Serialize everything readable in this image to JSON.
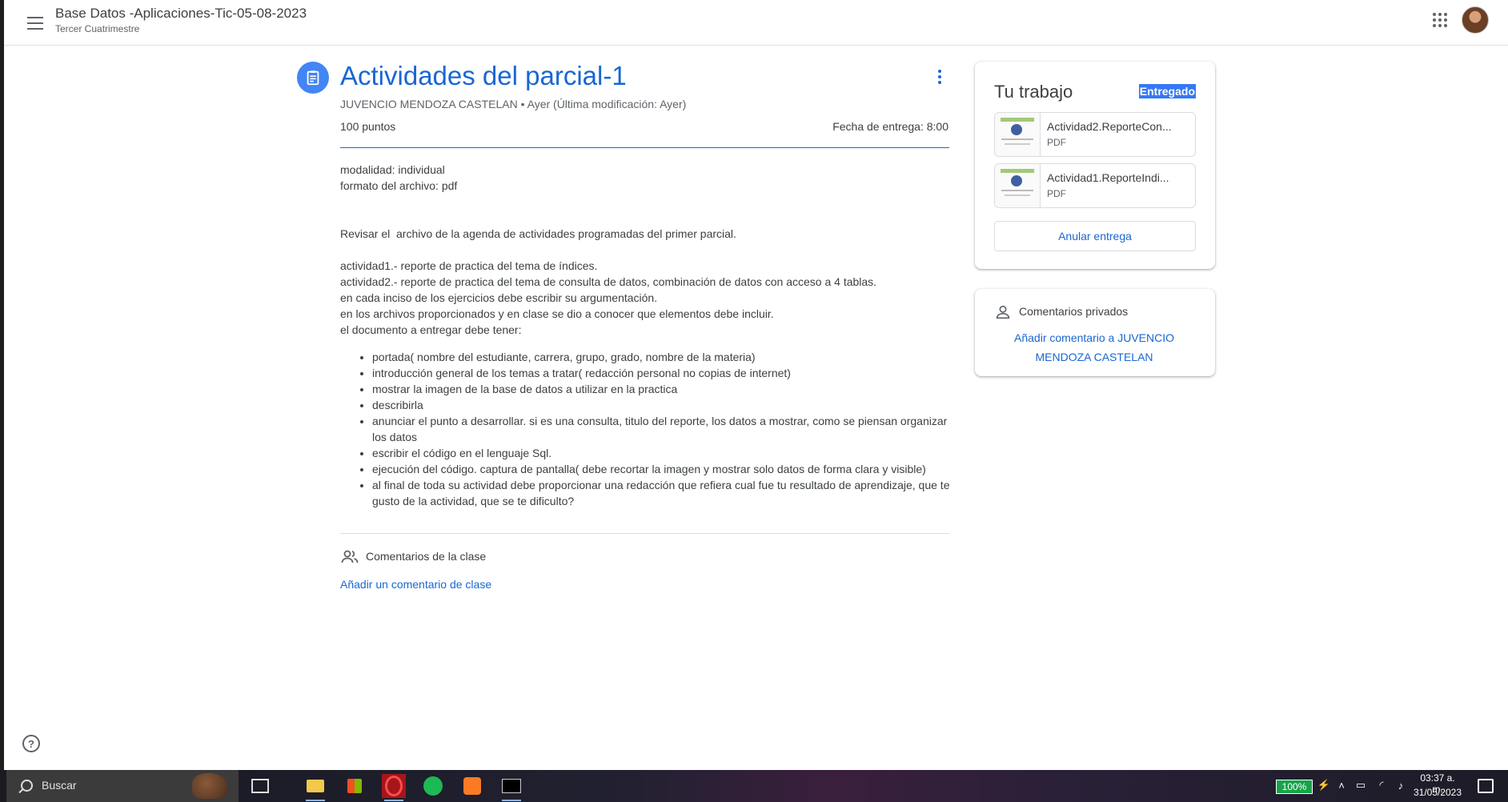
{
  "header": {
    "class_title": "Base Datos -Aplicaciones-Tic-05-08-2023",
    "class_subtitle": "Tercer Cuatrimestre"
  },
  "assignment": {
    "title": "Actividades del parcial-1",
    "meta": "JUVENCIO MENDOZA CASTELAN • Ayer (Última modificación: Ayer)",
    "points": "100 puntos",
    "due": "Fecha de entrega: 8:00",
    "description": {
      "line1": "modalidad: individual",
      "line2": "formato del archivo: pdf",
      "line3": "Revisar el  archivo de la agenda de actividades programadas del primer parcial.",
      "line4": "actividad1.- reporte de practica del tema de índices.",
      "line5": "actividad2.- reporte de practica del tema de consulta de datos, combinación de datos con acceso a 4 tablas.",
      "line6": "en cada inciso de los ejercicios debe escribir su argumentación.",
      "line7": "en los archivos proporcionados y en clase se dio a conocer que elementos debe incluir.",
      "line8": "el documento a entregar debe tener:"
    },
    "bullets": [
      "portada( nombre del estudiante, carrera, grupo, grado, nombre de la materia)",
      "introducción general de los temas a tratar( redacción personal no copias de internet)",
      "mostrar la imagen de la base de datos a utilizar en la practica",
      "describirla",
      "anunciar el punto a desarrollar. si es una consulta, titulo del reporte, los datos a mostrar, como se piensan organizar los datos",
      "escribir el código en el lenguaje Sql.",
      "ejecución del código. captura de pantalla( debe recortar la imagen y mostrar solo datos de forma clara y visible)",
      "al final de toda su actividad debe proporcionar una redacción que refiera cual fue tu resultado de aprendizaje, que te gusto de la actividad, que se te dificulto?"
    ],
    "class_comments_label": "Comentarios de la clase",
    "add_class_comment": "Añadir un comentario de clase"
  },
  "your_work": {
    "title": "Tu trabajo",
    "status": "Entregado",
    "files": [
      {
        "name": "Actividad2.ReporteCon...",
        "type": "PDF"
      },
      {
        "name": "Actividad1.ReporteIndi...",
        "type": "PDF"
      }
    ],
    "unsubmit_label": "Anular entrega"
  },
  "private_comments": {
    "title": "Comentarios privados",
    "add_label": "Añadir comentario a JUVENCIO MENDOZA CASTELAN"
  },
  "taskbar": {
    "search_placeholder": "Buscar",
    "battery": "100%",
    "time": "03:37 a. m.",
    "date": "31/05/2023"
  },
  "colors": {
    "accent": "#1967d2",
    "icon_blue": "#4285f4",
    "status_highlight": "#3478f6"
  },
  "icons": [
    "menu-icon",
    "assignment-icon",
    "more-vert-icon",
    "apps-icon",
    "people-icon",
    "person-icon",
    "help-icon",
    "search-icon",
    "pdf-thumbnail"
  ]
}
